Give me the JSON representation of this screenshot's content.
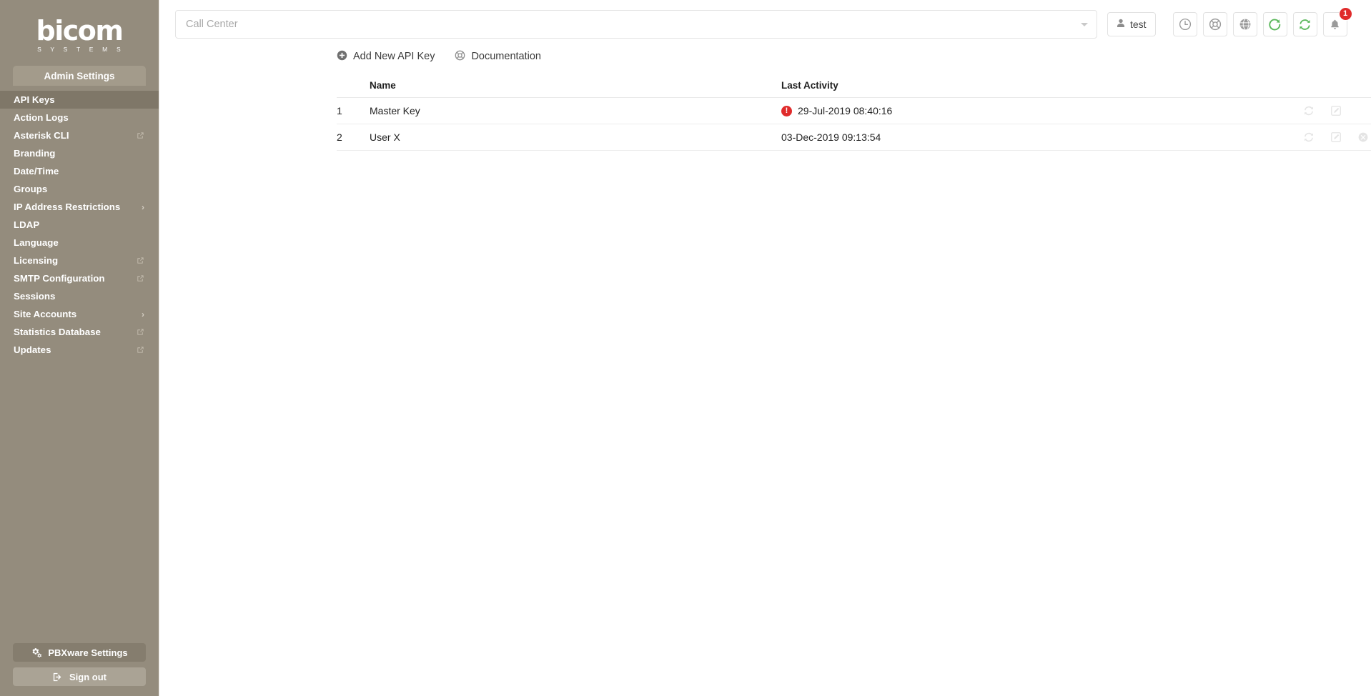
{
  "brand": {
    "logo_word": "bicom",
    "logo_sub": "S Y S T E M S",
    "sidebar_color": "#948c7d",
    "active_item_color": "#7f7768",
    "accent_green": "#5cb85c",
    "alert_red": "#e02b2b"
  },
  "sidebar": {
    "section_tab": "Admin Settings",
    "items": [
      {
        "label": "API Keys",
        "trailing": "",
        "active": true
      },
      {
        "label": "Action Logs",
        "trailing": "",
        "active": false
      },
      {
        "label": "Asterisk CLI",
        "trailing": "external",
        "active": false
      },
      {
        "label": "Branding",
        "trailing": "",
        "active": false
      },
      {
        "label": "Date/Time",
        "trailing": "",
        "active": false
      },
      {
        "label": "Groups",
        "trailing": "",
        "active": false
      },
      {
        "label": "IP Address Restrictions",
        "trailing": "chevron",
        "active": false
      },
      {
        "label": "LDAP",
        "trailing": "",
        "active": false
      },
      {
        "label": "Language",
        "trailing": "",
        "active": false
      },
      {
        "label": "Licensing",
        "trailing": "external",
        "active": false
      },
      {
        "label": "SMTP Configuration",
        "trailing": "external",
        "active": false
      },
      {
        "label": "Sessions",
        "trailing": "",
        "active": false
      },
      {
        "label": "Site Accounts",
        "trailing": "chevron",
        "active": false
      },
      {
        "label": "Statistics Database",
        "trailing": "external",
        "active": false
      },
      {
        "label": "Updates",
        "trailing": "external",
        "active": false
      }
    ],
    "settings_button": "PBXware Settings",
    "signout_button": "Sign out"
  },
  "topbar": {
    "tenant_select_placeholder": "Call Center",
    "tenant_select_value": "",
    "user_label": "test",
    "icons": [
      {
        "name": "clock-icon",
        "tint": "gray"
      },
      {
        "name": "support-lifebuoy-icon",
        "tint": "gray"
      },
      {
        "name": "globe-icon",
        "tint": "gray"
      },
      {
        "name": "reload-icon",
        "tint": "green"
      },
      {
        "name": "sync-icon",
        "tint": "green"
      },
      {
        "name": "bell-icon",
        "tint": "gray"
      }
    ],
    "notification_count": "1"
  },
  "toolbar": {
    "add_key_label": "Add New API Key",
    "documentation_label": "Documentation"
  },
  "table": {
    "columns": [
      "",
      "Name",
      "Last Activity",
      ""
    ],
    "rows": [
      {
        "index": "1",
        "name": "Master Key",
        "last_activity": "29-Jul-2019 08:40:16",
        "has_alert": true,
        "actions": [
          "refresh",
          "edit"
        ]
      },
      {
        "index": "2",
        "name": "User X",
        "last_activity": "03-Dec-2019 09:13:54",
        "has_alert": false,
        "actions": [
          "refresh",
          "edit",
          "delete"
        ]
      }
    ]
  }
}
